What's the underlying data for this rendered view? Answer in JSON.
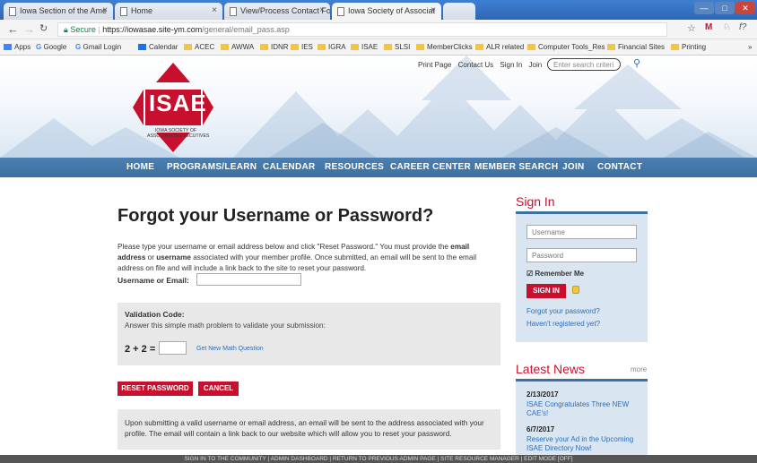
{
  "browser": {
    "tabs": [
      {
        "title": "Iowa Section of the Ame"
      },
      {
        "title": "Home"
      },
      {
        "title": "View/Process Contact Fo"
      },
      {
        "title": "Iowa Society of Associat"
      }
    ],
    "secure_label": "Secure",
    "url_host": "https://iowasae.site-ym.com",
    "url_path": "/general/email_pass.asp",
    "bookmarks": [
      "Apps",
      "Google",
      "Gmail Login",
      "Calendar",
      "ACEC",
      "AWWA",
      "IDNR",
      "IES",
      "IGRA",
      "ISAE",
      "SLSI",
      "MemberClicks",
      "ALR related",
      "Computer Tools_Res",
      "Financial Sites",
      "Printing"
    ]
  },
  "header": {
    "links": [
      "Print Page",
      "Contact Us",
      "Sign In",
      "Join"
    ],
    "search_placeholder": "Enter search criteri",
    "logo_text": "ISAE",
    "logo_sub1": "IOWA SOCIETY OF",
    "logo_sub2": "ASSOCIATION EXECUTIVES"
  },
  "nav": [
    "HOME",
    "PROGRAMS/LEARN",
    "CALENDAR",
    "RESOURCES",
    "CAREER CENTER",
    "MEMBER SEARCH",
    "JOIN",
    "CONTACT"
  ],
  "main": {
    "title": "Forgot your Username or Password?",
    "intro_1": "Please type your username or email address below and click \"Reset Password.\" You must provide the ",
    "intro_b1": "email address",
    "intro_2": " or ",
    "intro_b2": "username",
    "intro_3": " associated with your member profile. Once submitted, an email will be sent to the email address on file and will include a link back to the site to reset your password.",
    "username_label": "Username or Email:",
    "validation_title": "Validation Code:",
    "validation_sub": "Answer this simple math problem to validate your submission:",
    "math_question": "2 + 2 =",
    "new_math_link": "Get New Math Question",
    "reset_button": "RESET PASSWORD",
    "cancel_button": "CANCEL",
    "info_text": "Upon submitting a valid username or email address, an email will be sent to the address associated with your profile. The email will contain a link back to our website which will allow you to reset your password."
  },
  "signin": {
    "title": "Sign In",
    "username_placeholder": "Username",
    "password_placeholder": "Password",
    "remember_label": "Remember Me",
    "button": "SIGN IN",
    "forgot_link": "Forgot your password?",
    "register_link": "Haven't registered yet?"
  },
  "news": {
    "title": "Latest News",
    "more": "more",
    "items": [
      {
        "date": "2/13/2017",
        "text": "ISAE Congratulates Three NEW CAE's!"
      },
      {
        "date": "6/7/2017",
        "text": "Reserve your Ad in the Upcoming ISAE Directory Now!"
      }
    ]
  },
  "footer": "SIGN IN TO THE COMMUNITY | ADMIN DASHBOARD | RETURN TO PREVIOUS ADMIN PAGE | SITE RESOURCE MANAGER | EDIT MODE [OFF]"
}
